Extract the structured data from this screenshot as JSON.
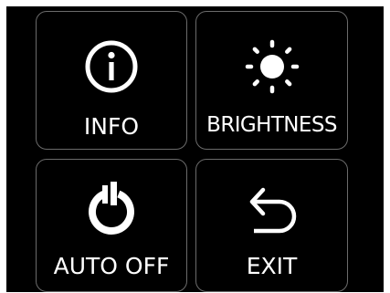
{
  "menu": {
    "tiles": [
      {
        "label": "INFO",
        "icon": "info-icon"
      },
      {
        "label": "BRIGHTNESS",
        "icon": "sun-icon"
      },
      {
        "label": "AUTO OFF",
        "icon": "power-icon"
      },
      {
        "label": "EXIT",
        "icon": "back-arrow-icon"
      }
    ]
  },
  "colors": {
    "background": "#000000",
    "foreground": "#ffffff",
    "tile_border": "#6b6b6b"
  }
}
